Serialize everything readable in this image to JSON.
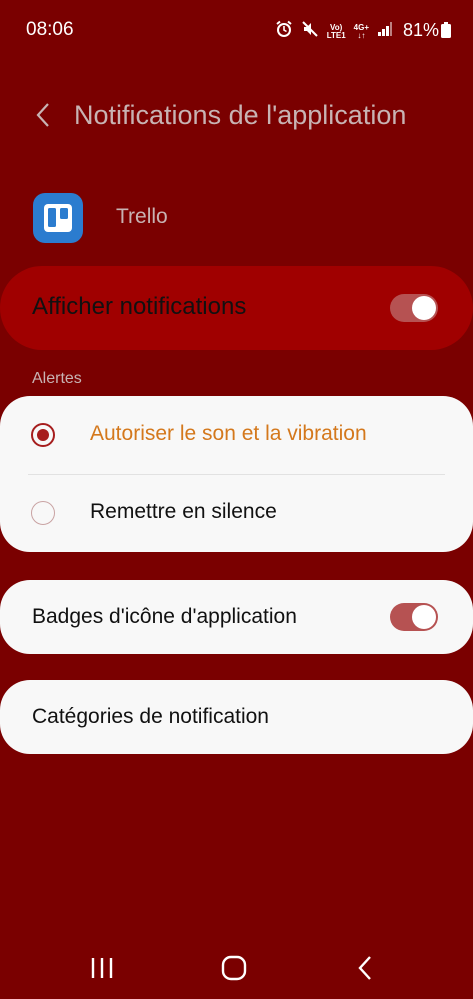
{
  "status_bar": {
    "time": "08:06",
    "net_top": "Vo)",
    "net_bottom": "LTE1",
    "gen_top": "4G+",
    "gen_bottom": "↓↑",
    "battery": "81%"
  },
  "header": {
    "title": "Notifications de l'application"
  },
  "app": {
    "name": "Trello"
  },
  "master_toggle": {
    "label": "Afficher notifications",
    "on": true
  },
  "alerts": {
    "section_label": "Alertes",
    "options": [
      {
        "label": "Autoriser le son et la vibration",
        "selected": true
      },
      {
        "label": "Remettre en silence",
        "selected": false
      }
    ]
  },
  "badges": {
    "label": "Badges d'icône d'application",
    "on": true
  },
  "categories": {
    "label": "Catégories de notification"
  },
  "colors": {
    "background": "#7a0000",
    "master_card": "#a00000",
    "accent": "#d4781c",
    "radio": "#a61d1d",
    "toggle_track": "#b65252"
  }
}
